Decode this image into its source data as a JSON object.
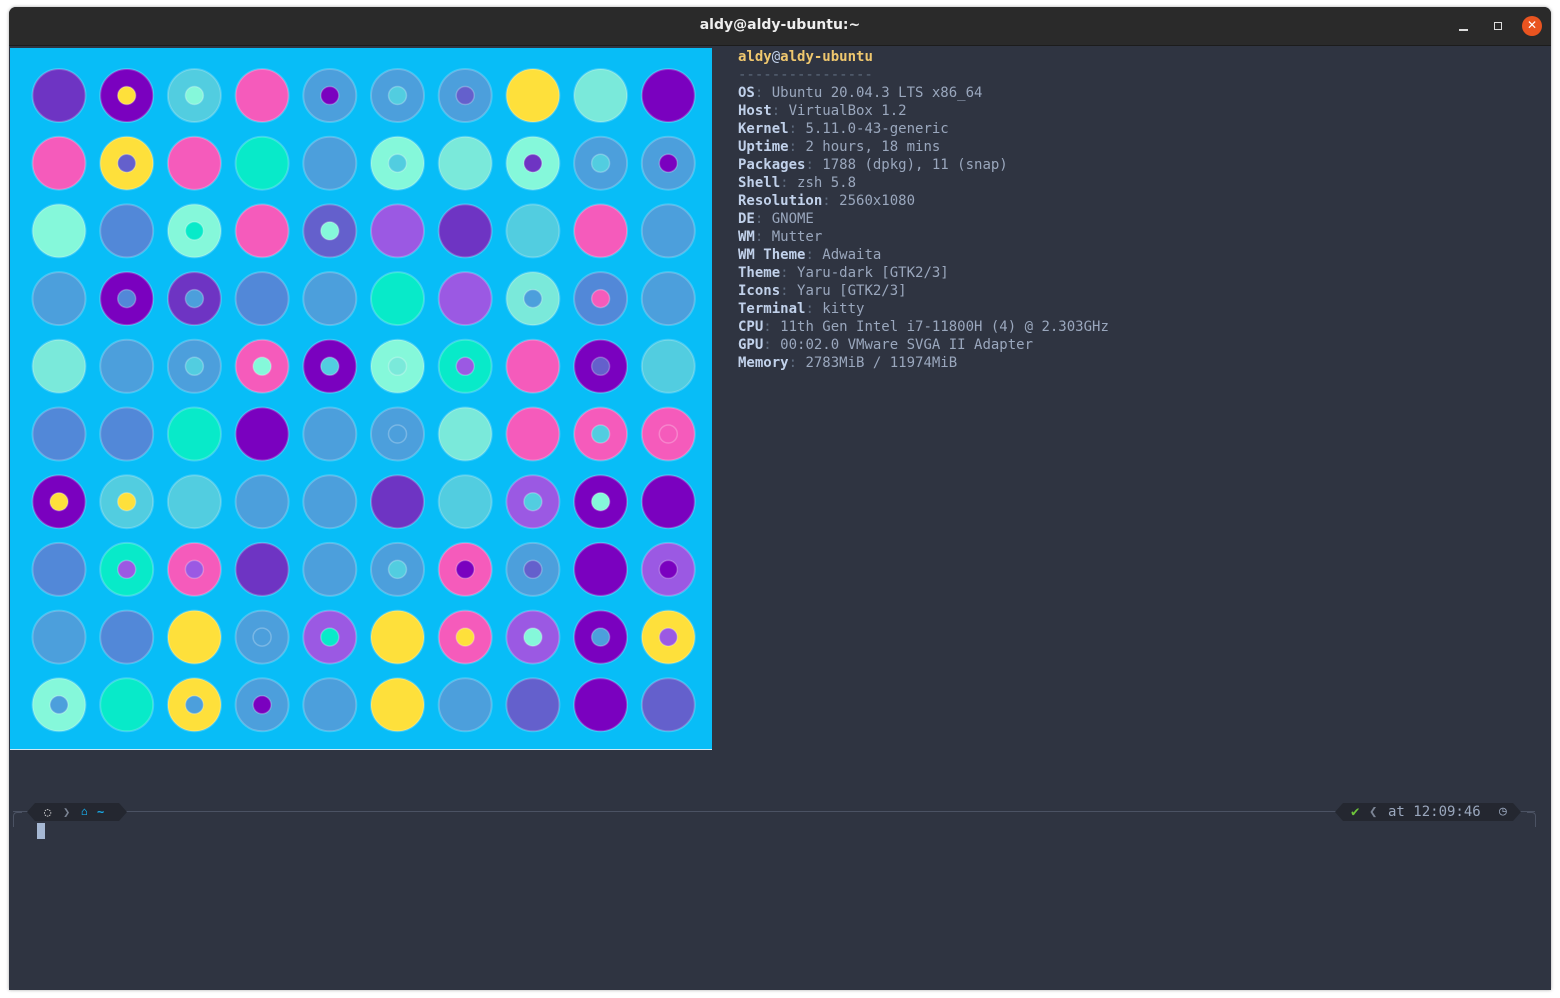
{
  "window": {
    "title": "aldy@aldy-ubuntu:~",
    "buttons": {
      "minimize": "minimize-icon",
      "maximize": "maximize-icon",
      "close": "✕"
    }
  },
  "colors": {
    "terminal_bg": "#2f3441",
    "image_bg": "#08bdf7",
    "header_accent": "#efc76e",
    "key_color": "#c1d1ea",
    "value_color": "#9aa7bd",
    "close_button": "#e95420",
    "path_color": "#18a9e6",
    "ok_color": "#6ec43b"
  },
  "image": {
    "palette": {
      "V": "#7a01bf",
      "P": "#6e34c3",
      "L": "#9b59e3",
      "I": "#6460cc",
      "B": "#5288d8",
      "S": "#4c9fdc",
      "T": "#52cde0",
      "M": "#7ae9da",
      "N": "#85f8da",
      "C": "#08eac9",
      "K": "#f55bbb",
      "Y": "#fee03b"
    },
    "grid": [
      [
        "P",
        "V:Y",
        "T:N",
        "K",
        "S:V",
        "S:T",
        "S:I",
        "Y",
        "M",
        "V"
      ],
      [
        "K",
        "Y:I",
        "K",
        "C",
        "S",
        "N:T",
        "M",
        "N:P",
        "S:T",
        "S:V"
      ],
      [
        "N",
        "B",
        "N:C",
        "K",
        "I:N",
        "L",
        "P",
        "T",
        "K",
        "S"
      ],
      [
        "S",
        "V:B",
        "P:S",
        "B",
        "S",
        "C",
        "L",
        "M:S",
        "B:K",
        "S"
      ],
      [
        "M",
        "S",
        "S:T",
        "K:N",
        "V:T",
        "N:M",
        "C:L",
        "K",
        "V:I",
        "T"
      ],
      [
        "B",
        "B",
        "C",
        "V",
        "S",
        "S:S",
        "M",
        "K",
        "K:T",
        "K:K"
      ],
      [
        "V:Y",
        "T:Y",
        "T",
        "S",
        "S",
        "P",
        "T",
        "L:T",
        "V:N",
        "V"
      ],
      [
        "B",
        "C:L",
        "K:L",
        "P",
        "S",
        "S:T",
        "K:V",
        "S:I",
        "V",
        "L:V"
      ],
      [
        "S",
        "B",
        "Y",
        "S:S",
        "L:C",
        "Y",
        "K:Y",
        "L:N",
        "V:S",
        "Y:L"
      ],
      [
        "N:S",
        "C",
        "Y:S",
        "S:V",
        "S",
        "Y",
        "S",
        "I",
        "V",
        "I"
      ]
    ]
  },
  "neofetch": {
    "user": "aldy",
    "at": "@",
    "host": "aldy-ubuntu",
    "separator": "----------------",
    "fields": [
      {
        "key": "OS",
        "value": "Ubuntu 20.04.3 LTS x86_64"
      },
      {
        "key": "Host",
        "value": "VirtualBox 1.2"
      },
      {
        "key": "Kernel",
        "value": "5.11.0-43-generic"
      },
      {
        "key": "Uptime",
        "value": "2 hours, 18 mins"
      },
      {
        "key": "Packages",
        "value": "1788 (dpkg), 11 (snap)"
      },
      {
        "key": "Shell",
        "value": "zsh 5.8"
      },
      {
        "key": "Resolution",
        "value": "2560x1080"
      },
      {
        "key": "DE",
        "value": "GNOME"
      },
      {
        "key": "WM",
        "value": "Mutter"
      },
      {
        "key": "WM Theme",
        "value": "Adwaita"
      },
      {
        "key": "Theme",
        "value": "Yaru-dark [GTK2/3]"
      },
      {
        "key": "Icons",
        "value": "Yaru [GTK2/3]"
      },
      {
        "key": "Terminal",
        "value": "kitty"
      },
      {
        "key": "CPU",
        "value": "11th Gen Intel i7-11800H (4) @ 2.303GHz"
      },
      {
        "key": "GPU",
        "value": "00:02.0 VMware SVGA II Adapter"
      },
      {
        "key": "Memory",
        "value": "2783MiB / 11974MiB"
      }
    ],
    "key_separator": ": "
  },
  "prompt": {
    "os_icon": "ubuntu-icon",
    "separator_right": "❯",
    "home_icon": "home-icon",
    "path": "~",
    "status": "✔",
    "separator_left": "❮",
    "time_label": "at 12:09:46",
    "clock_icon": "clock-icon"
  }
}
